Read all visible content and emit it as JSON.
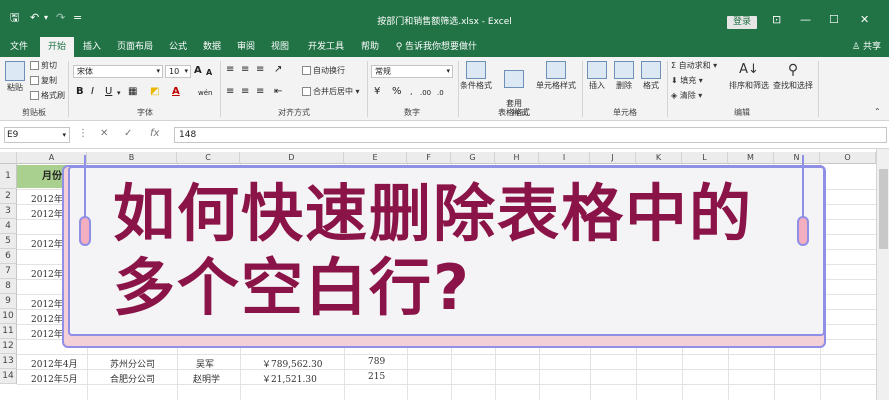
{
  "titlebar": {
    "title": "按部门和销售额筛选.xlsx - Excel",
    "login": "登录",
    "save_glyph": "🖫",
    "undo_glyph": "↶",
    "redo_glyph": "↷",
    "more_glyph": "=",
    "ribbon_opt_glyph": "⊡",
    "min_glyph": "—",
    "max_glyph": "☐",
    "close_glyph": "✕"
  },
  "tabs": {
    "items": [
      "文件",
      "开始",
      "插入",
      "页面布局",
      "公式",
      "数据",
      "审阅",
      "视图",
      "开发工具",
      "帮助",
      "告诉我你想要做什么"
    ],
    "share": "共享"
  },
  "ribbon": {
    "clipboard": {
      "paste": "粘贴",
      "cut": "剪切",
      "copy": "复制",
      "format_painter": "格式刷",
      "label": "剪贴板"
    },
    "font": {
      "name": "宋体",
      "size": "10",
      "grow": "A",
      "shrink": "A",
      "bold": "B",
      "italic": "I",
      "underline": "U",
      "color_a": "A",
      "phonetic": "wén",
      "label": "字体"
    },
    "alignment": {
      "wrap": "自动换行",
      "merge": "合并后居中",
      "label": "对齐方式"
    },
    "number": {
      "format": "常规",
      "label": "数字"
    },
    "styles": {
      "conditional": "条件格式",
      "table": "套用\n表格格式",
      "cell": "单元格样式",
      "label": "样式"
    },
    "cells": {
      "insert": "插入",
      "delete": "删除",
      "format": "格式",
      "label": "单元格"
    },
    "editing": {
      "autosum": "自动求和",
      "fill": "填充",
      "clear": "清除",
      "sort": "排序和筛选",
      "find": "查找和选择",
      "label": "编辑"
    }
  },
  "formula_bar": {
    "name_box": "E9",
    "cancel": "✕",
    "enter": "✓",
    "fx": "fx",
    "value": "148"
  },
  "grid": {
    "columns": [
      "A",
      "B",
      "C",
      "D",
      "E",
      "F",
      "G",
      "H",
      "I",
      "J",
      "K",
      "L",
      "M",
      "N",
      "O"
    ],
    "rows": [
      "1",
      "2",
      "3",
      "4",
      "5",
      "6",
      "7",
      "8",
      "9",
      "10",
      "11",
      "12",
      "13",
      "14"
    ],
    "header_a1": "月份",
    "col_a_visible": [
      "2012年4",
      "2012年4",
      "2012年4",
      "2012年4",
      "2012年4",
      "2012年4",
      "2012年4"
    ],
    "row13": {
      "a": "2012年4月",
      "b": "苏州分公司",
      "c": "吴军",
      "d": "￥789,562.30",
      "e": "789"
    },
    "row14": {
      "a": "2012年5月",
      "b": "合肥分公司",
      "c": "赵明学",
      "d": "￥21,521.30",
      "e": "215"
    }
  },
  "banner": {
    "line1": "如何快速删除表格中的",
    "line2": "多个空白行?"
  },
  "colors": {
    "excel_green": "#217346",
    "banner_text": "#8a1447",
    "banner_border": "#8f8fe6",
    "header_fill": "#a9d08e"
  }
}
